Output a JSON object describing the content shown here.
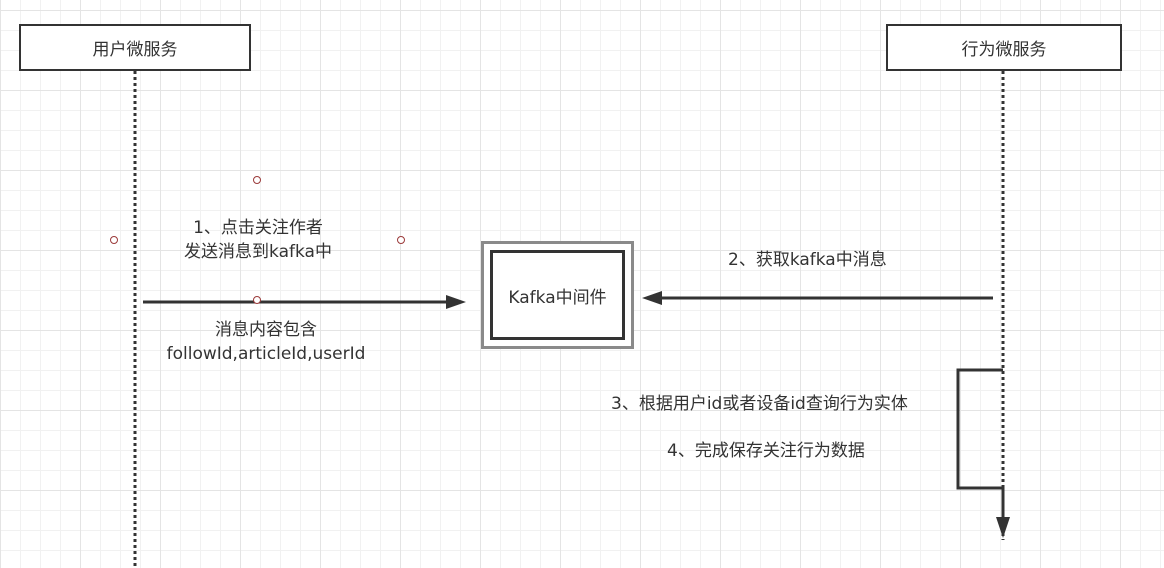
{
  "participants": {
    "user_service": "用户微服务",
    "behavior_service": "行为微服务"
  },
  "middleware": {
    "kafka": "Kafka中间件"
  },
  "messages": {
    "step1_line1": "1、点击关注作者",
    "step1_line2": "发送消息到kafka中",
    "step1_note_line1": "消息内容包含",
    "step1_note_line2": "followId,articleId,userId",
    "step2": "2、获取kafka中消息",
    "step3": "3、根据用户id或者设备id查询行为实体",
    "step4": "4、完成保存关注行为数据"
  }
}
